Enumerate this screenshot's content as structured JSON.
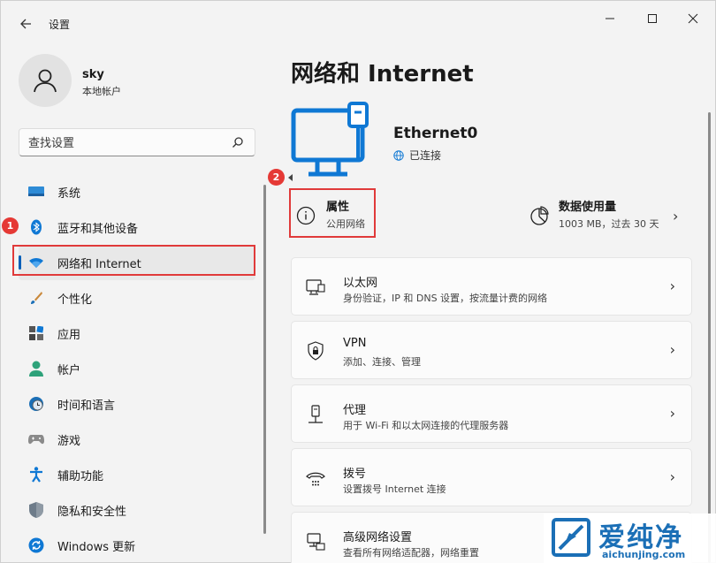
{
  "window": {
    "title": "设置",
    "controls": [
      "minimize",
      "maximize",
      "close"
    ]
  },
  "profile": {
    "name": "sky",
    "type": "本地帐户"
  },
  "search": {
    "placeholder": "查找设置"
  },
  "sidebar": {
    "items": [
      {
        "label": "系统",
        "icon": "system-icon"
      },
      {
        "label": "蓝牙和其他设备",
        "icon": "bluetooth-icon"
      },
      {
        "label": "网络和 Internet",
        "icon": "wifi-icon",
        "active": true
      },
      {
        "label": "个性化",
        "icon": "brush-icon"
      },
      {
        "label": "应用",
        "icon": "apps-icon"
      },
      {
        "label": "帐户",
        "icon": "account-icon"
      },
      {
        "label": "时间和语言",
        "icon": "clock-globe-icon"
      },
      {
        "label": "游戏",
        "icon": "gamepad-icon"
      },
      {
        "label": "辅助功能",
        "icon": "accessibility-icon"
      },
      {
        "label": "隐私和安全性",
        "icon": "shield-icon"
      },
      {
        "label": "Windows 更新",
        "icon": "update-icon"
      }
    ]
  },
  "annotations": {
    "badge1": "1",
    "badge2": "2",
    "highlight_color": "#e03a3a"
  },
  "main": {
    "title": "网络和 Internet",
    "adapter": {
      "name": "Ethernet0",
      "status": "已连接"
    },
    "properties": {
      "title": "属性",
      "subtitle": "公用网络"
    },
    "data_usage": {
      "title": "数据使用量",
      "subtitle": "1003 MB，过去 30 天"
    },
    "cards": [
      {
        "title": "以太网",
        "subtitle": "身份验证，IP 和 DNS 设置，按流量计费的网络",
        "icon": "ethernet-icon"
      },
      {
        "title": "VPN",
        "subtitle": "添加、连接、管理",
        "icon": "vpn-shield-icon"
      },
      {
        "title": "代理",
        "subtitle": "用于 Wi-Fi 和以太网连接的代理服务器",
        "icon": "proxy-icon"
      },
      {
        "title": "拨号",
        "subtitle": "设置拨号 Internet 连接",
        "icon": "dialup-icon"
      },
      {
        "title": "高级网络设置",
        "subtitle": "查看所有网络适配器，网络重置",
        "icon": "advanced-network-icon"
      }
    ]
  },
  "watermark": {
    "text": "爱纯净",
    "url": "aichunjing.com"
  },
  "colors": {
    "accent": "#005fb8",
    "icon_blue": "#0f78d4"
  }
}
